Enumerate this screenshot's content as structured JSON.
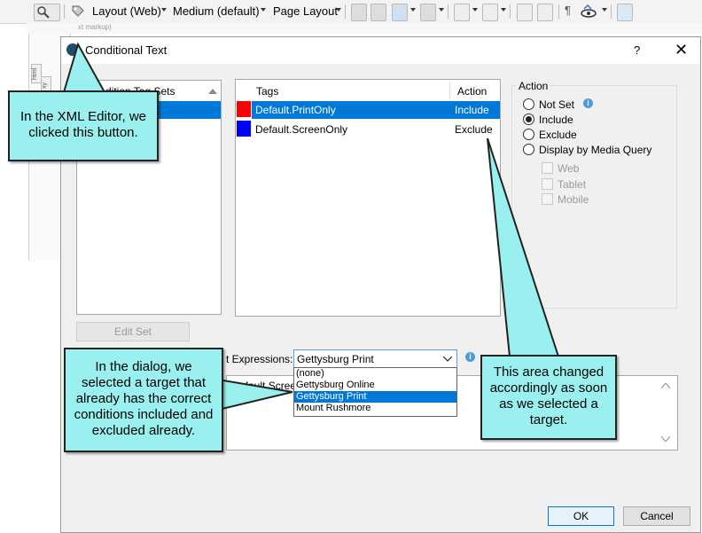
{
  "toolbar": {
    "layout_label": "Layout (Web)",
    "medium_label": "Medium (default)",
    "page_layout_label": "Page Layout",
    "subbar_text": "xt markup)"
  },
  "editor_tabs": [
    "html",
    "xy"
  ],
  "dialog": {
    "title": "Conditional Text",
    "help": "?",
    "close": "✕",
    "tagsets_header": "dition Tag Sets",
    "tags_header": "Tags",
    "action_header": "Action",
    "tags": [
      {
        "name": "Default.PrintOnly",
        "action": "Include",
        "color": "#ff0000",
        "selected": true
      },
      {
        "name": "Default.ScreenOnly",
        "action": "Exclude",
        "color": "#0000ff",
        "selected": false
      }
    ],
    "edit_set_label": "Edit Set",
    "action_group_label": "Action",
    "actions": [
      "Not Set",
      "Include",
      "Exclude",
      "Display by Media Query"
    ],
    "selected_action": "Include",
    "media_options": [
      "Web",
      "Tablet",
      "Mobile"
    ],
    "expressions_label": "t Expressions:",
    "expression_selected": "Gettysburg Print",
    "expression_options": [
      "(none)",
      "Gettysburg Online",
      "Gettysburg Print",
      "Mount Rushmore"
    ],
    "expression_preview": "[Default.Screen",
    "ok_label": "OK",
    "cancel_label": "Cancel"
  },
  "callouts": {
    "toolbar_note": "In the XML Editor, we clicked this button.",
    "dialog_note": "In the dialog, we selected a target that already has the correct conditions included and excluded already.",
    "area_note": "This area changed accordingly as soon as we selected a target."
  },
  "colors": {
    "selection": "#0078d7",
    "callout_fill": "#99f0ee"
  },
  "icons": [
    "search-icon",
    "conditional-text-icon",
    "info-icon",
    "chevron-down-icon",
    "close-icon"
  ]
}
